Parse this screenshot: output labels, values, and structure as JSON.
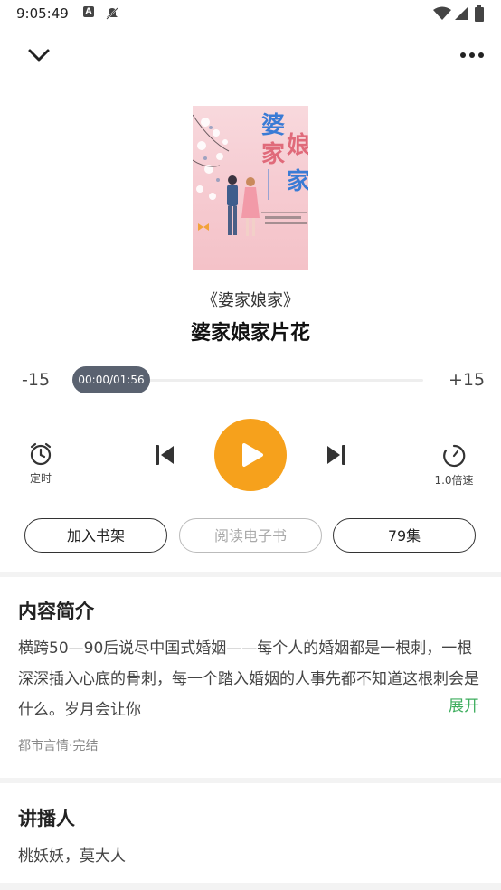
{
  "status_bar": {
    "time": "9:05:49",
    "icons": [
      "app-a-icon",
      "notification-off-icon",
      "wifi-icon",
      "cellular-icon",
      "battery-icon"
    ]
  },
  "header": {
    "collapse_icon": "chevron-down-icon",
    "more_icon": "more-dots-icon"
  },
  "cover": {
    "title_chars": [
      "婆",
      "家",
      "娘",
      "家"
    ]
  },
  "book": {
    "name": "《婆家娘家》",
    "episode_title": "婆家娘家片花"
  },
  "progress": {
    "rewind_label": "-15",
    "forward_label": "+15",
    "time_display": "00:00/01:56",
    "fraction": 0.0
  },
  "controls": {
    "timer_label": "定时",
    "speed_label": "1.0倍速"
  },
  "actions": {
    "add_shelf": "加入书架",
    "read_ebook": "阅读电子书",
    "episodes": "79集"
  },
  "intro": {
    "title": "内容简介",
    "text": "横跨50—90后说尽中国式婚姻——每个人的婚姻都是一根刺，一根深深插入心底的骨刺，每一个踏入婚姻的人事先都不知道这根刺会是什么。岁月会让你",
    "expand": "展开",
    "tags": "都市言情·完结"
  },
  "narrator": {
    "title": "讲播人",
    "names": "桃妖妖，莫大人"
  },
  "colors": {
    "accent": "#f6a11c",
    "expand_green": "#3fae5f",
    "thumb": "#5a6270"
  }
}
